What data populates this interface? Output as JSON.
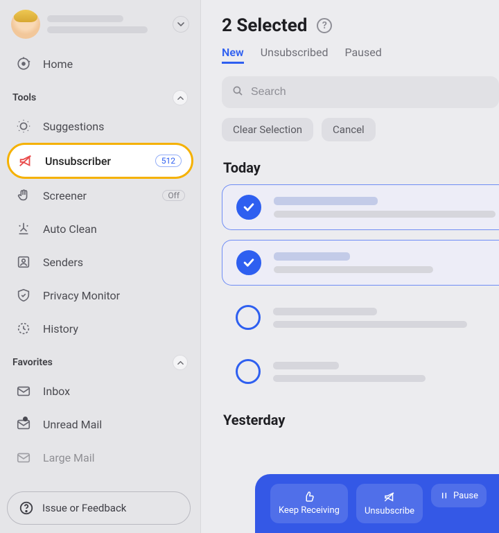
{
  "profile": {},
  "sidebar": {
    "home": "Home",
    "tools_header": "Tools",
    "favorites_header": "Favorites",
    "suggestions": "Suggestions",
    "unsubscriber": {
      "label": "Unsubscriber",
      "count": "512"
    },
    "screener": {
      "label": "Screener",
      "status": "Off"
    },
    "autoclean": "Auto Clean",
    "senders": "Senders",
    "privacy": "Privacy Monitor",
    "history": "History",
    "inbox": "Inbox",
    "unread": "Unread Mail",
    "large": "Large Mail",
    "feedback": "Issue or Feedback"
  },
  "main": {
    "title": "2 Selected",
    "tabs": {
      "new": "New",
      "unsubscribed": "Unsubscribed",
      "paused": "Paused"
    },
    "search_placeholder": "Search",
    "chips": {
      "clear": "Clear Selection",
      "cancel": "Cancel"
    },
    "groups": {
      "today": "Today",
      "yesterday": "Yesterday"
    },
    "items": [
      {
        "selected": true
      },
      {
        "selected": true
      },
      {
        "selected": false
      },
      {
        "selected": false
      }
    ]
  },
  "actionbar": {
    "keep": "Keep Receiving",
    "unsubscribe": "Unsubscribe",
    "pause": "Pause"
  }
}
